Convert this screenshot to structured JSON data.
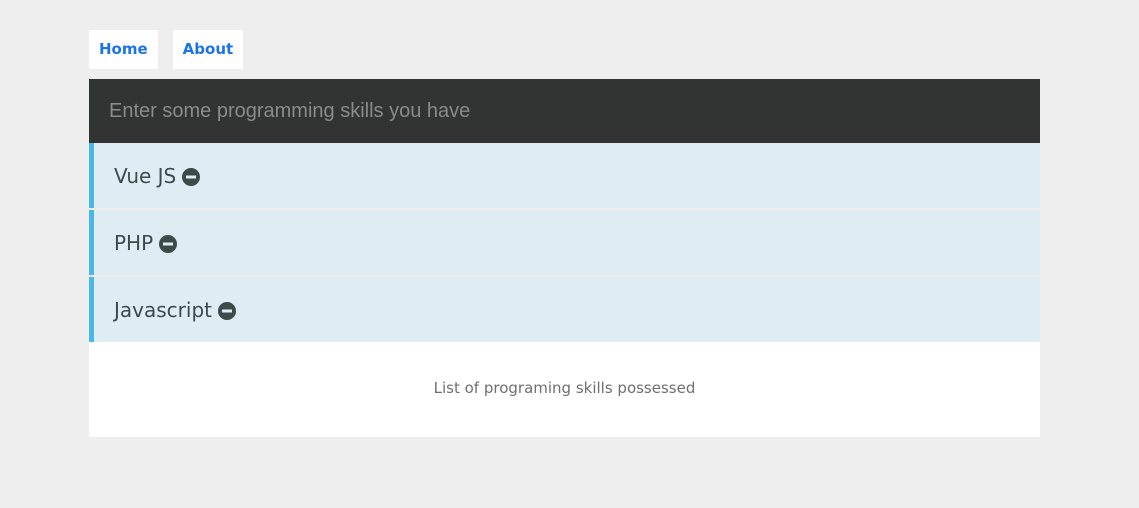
{
  "nav": {
    "home_label": "Home",
    "about_label": "About"
  },
  "skill_input": {
    "placeholder": "Enter some programming skills you have",
    "value": ""
  },
  "skills": [
    {
      "label": "Vue JS",
      "remove_icon": "minus-circle-icon"
    },
    {
      "label": "PHP",
      "remove_icon": "minus-circle-icon"
    },
    {
      "label": "Javascript",
      "remove_icon": "minus-circle-icon"
    }
  ],
  "footer": {
    "text": "List of programing skills possessed"
  },
  "colors": {
    "page_background": "#eeeeee",
    "nav_link": "#1a73e8",
    "input_background": "#323333",
    "skill_background": "#e0ecf4",
    "skill_accent": "#49b8e6",
    "icon": "#3c4a4a"
  }
}
